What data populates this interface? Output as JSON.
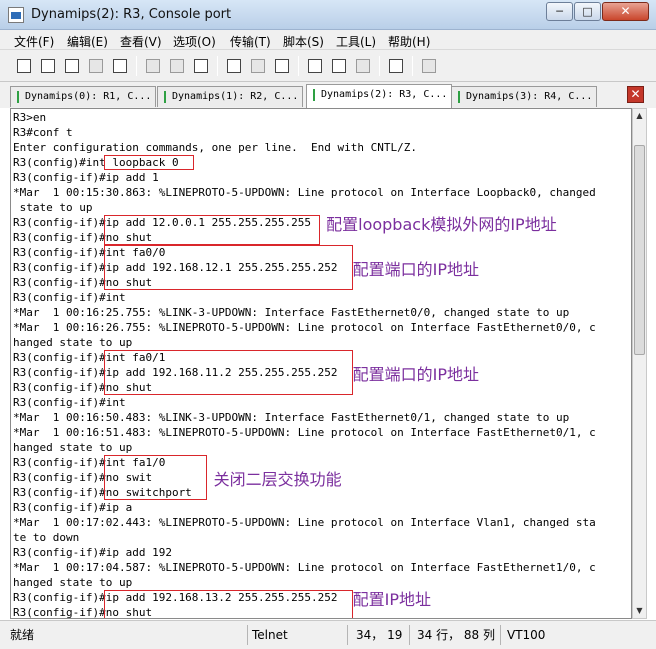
{
  "window": {
    "title": "Dynamips(2): R3, Console port",
    "min": "─",
    "max": "□",
    "close": "✕"
  },
  "menu": [
    "文件(F)",
    "编辑(E)",
    "查看(V)",
    "选项(O)",
    "传输(T)",
    "脚本(S)",
    "工具(L)",
    "帮助(H)"
  ],
  "tabs": [
    "Dynamips(0): R1, C...",
    "Dynamips(1): R2, C...",
    "Dynamips(2): R3, C...",
    "Dynamips(3): R4, C..."
  ],
  "active_tab": 2,
  "tab_close": "✕",
  "terminal_lines": [
    "R3>en",
    "R3#conf t",
    "Enter configuration commands, one per line.  End with CNTL/Z.",
    "R3(config)#int loopback 0",
    "R3(config-if)#ip add 1",
    "*Mar  1 00:15:30.863: %LINEPROTO-5-UPDOWN: Line protocol on Interface Loopback0, changed",
    " state to up",
    "R3(config-if)#ip add 12.0.0.1 255.255.255.255",
    "R3(config-if)#no shut",
    "R3(config-if)#int fa0/0",
    "R3(config-if)#ip add 192.168.12.1 255.255.255.252",
    "R3(config-if)#no shut",
    "R3(config-if)#int",
    "*Mar  1 00:16:25.755: %LINK-3-UPDOWN: Interface FastEthernet0/0, changed state to up",
    "*Mar  1 00:16:26.755: %LINEPROTO-5-UPDOWN: Line protocol on Interface FastEthernet0/0, c",
    "hanged state to up",
    "R3(config-if)#int fa0/1",
    "R3(config-if)#ip add 192.168.11.2 255.255.255.252",
    "R3(config-if)#no shut",
    "R3(config-if)#int",
    "*Mar  1 00:16:50.483: %LINK-3-UPDOWN: Interface FastEthernet0/1, changed state to up",
    "*Mar  1 00:16:51.483: %LINEPROTO-5-UPDOWN: Line protocol on Interface FastEthernet0/1, c",
    "hanged state to up",
    "R3(config-if)#int fa1/0",
    "R3(config-if)#no swit",
    "R3(config-if)#no switchport",
    "R3(config-if)#ip a",
    "*Mar  1 00:17:02.443: %LINEPROTO-5-UPDOWN: Line protocol on Interface Vlan1, changed sta",
    "te to down",
    "R3(config-if)#ip add 192",
    "*Mar  1 00:17:04.587: %LINEPROTO-5-UPDOWN: Line protocol on Interface FastEthernet1/0, c",
    "hanged state to up",
    "R3(config-if)#ip add 192.168.13.2 255.255.255.252",
    "R3(config-if)#no shut"
  ],
  "annotations": [
    {
      "line": 7,
      "text": "配置loopback模拟外网的IP地址"
    },
    {
      "line": 10,
      "text": "配置端口的IP地址"
    },
    {
      "line": 17,
      "text": "配置端口的IP地址"
    },
    {
      "line": 24,
      "text": "关闭二层交换功能"
    },
    {
      "line": 32,
      "text": "配置IP地址"
    }
  ],
  "status": {
    "state": "就绪",
    "protocol": "Telnet",
    "cursor": "34， 19",
    "size": "34 行， 88 列",
    "emulation": "VT100"
  },
  "colors": {
    "highlight_border": "#d9262b",
    "annotation_text": "#7b2f9e"
  }
}
